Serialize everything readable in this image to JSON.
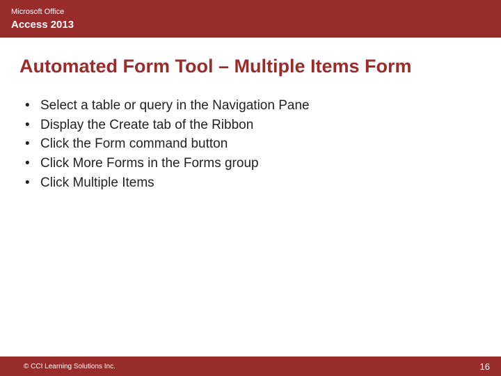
{
  "header": {
    "brand": "Microsoft Office",
    "product": "Access 2013"
  },
  "title": "Automated Form Tool – Multiple Items Form",
  "bullets": [
    "Select a table or query in the Navigation Pane",
    "Display the Create tab of the Ribbon",
    "Click the Form command button",
    "Click More Forms in the Forms group",
    "Click Multiple Items"
  ],
  "footer": {
    "copyright": "© CCI Learning Solutions Inc.",
    "page": "16"
  }
}
